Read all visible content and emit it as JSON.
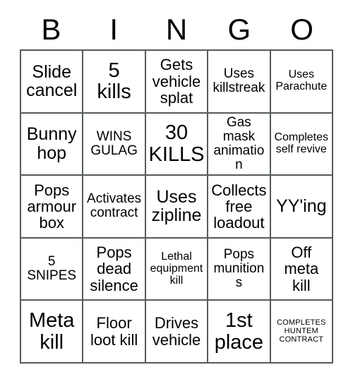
{
  "card": {
    "title": "Bingo Card",
    "header_letters": [
      "B",
      "I",
      "N",
      "G",
      "O"
    ],
    "colors": {
      "background": "#ffffff",
      "text": "#000000",
      "grid_line": "#555a5e"
    },
    "grid": {
      "columns": 5,
      "rows": 5
    },
    "cells": [
      {
        "text": "Slide\ncancel",
        "size": "xl"
      },
      {
        "text": "5\nkills",
        "size": "xxl"
      },
      {
        "text": "Gets\nvehicle\nsplat",
        "size": "lg"
      },
      {
        "text": "Uses\nkillstreak",
        "size": "md"
      },
      {
        "text": "Uses\nParachute",
        "size": "sm"
      },
      {
        "text": "Bunny\nhop",
        "size": "xl"
      },
      {
        "text": "WINS\nGULAG",
        "size": "md"
      },
      {
        "text": "30\nKILLS",
        "size": "xxl"
      },
      {
        "text": "Gas\nmask\nanimation",
        "size": "md"
      },
      {
        "text": "Completes\nself revive",
        "size": "sm"
      },
      {
        "text": "Pops\narmour\nbox",
        "size": "lg"
      },
      {
        "text": "Activates\ncontract",
        "size": "md"
      },
      {
        "text": "Uses\nzipline",
        "size": "xl"
      },
      {
        "text": "Collects\nfree\nloadout",
        "size": "lg"
      },
      {
        "text": "YY'ing",
        "size": "xl"
      },
      {
        "text": "5\nSNIPES",
        "size": "md"
      },
      {
        "text": "Pops\ndead\nsilence",
        "size": "lg"
      },
      {
        "text": "Lethal\nequipment\nkill",
        "size": "sm"
      },
      {
        "text": "Pops\nmunitions",
        "size": "md"
      },
      {
        "text": "Off\nmeta\nkill",
        "size": "lg"
      },
      {
        "text": "Meta\nkill",
        "size": "xxl"
      },
      {
        "text": "Floor\nloot kill",
        "size": "lg"
      },
      {
        "text": "Drives\nvehicle",
        "size": "lg"
      },
      {
        "text": "1st\nplace",
        "size": "xxl"
      },
      {
        "text": "COMPLETES\nHUNTEM\nCONTRACT",
        "size": "xxs"
      }
    ]
  }
}
